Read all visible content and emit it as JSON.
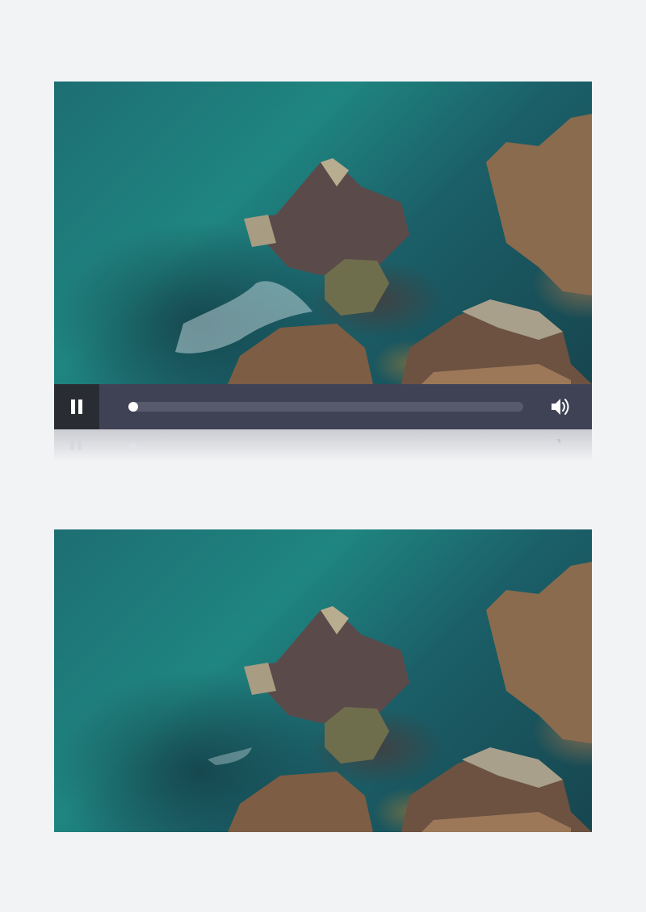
{
  "player": {
    "state": "playing",
    "play_pause_icon": "pause-icon",
    "progress": 0.0,
    "volume_icon": "volume-icon"
  },
  "colors": {
    "control_bar": "#3f4254",
    "play_button_bg": "#2a2c33",
    "track": "#575a6d",
    "page_background": "#f2f3f5"
  }
}
